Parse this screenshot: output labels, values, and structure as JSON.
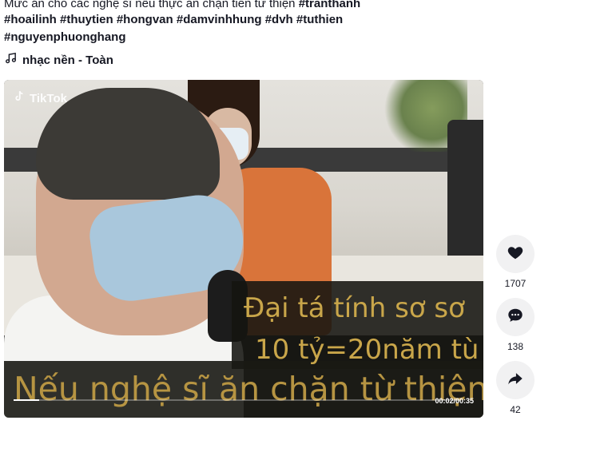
{
  "post": {
    "caption_line1": "Mức án cho các nghệ sĩ nếu thực ăn chặn tiền từ thiện",
    "hashtags_line1": "#tranthanh",
    "hashtags_line2": "#hoailinh #thuytien #hongvan #damvinhhung #dvh #tuthien",
    "hashtags_line3": "#nguyenphuonghang",
    "music_label": "nhạc nền - Toàn",
    "music_icon": "music-note-icon"
  },
  "video": {
    "watermark": "TikTok",
    "overlay_line1": "Đại tá tính sơ sơ",
    "overlay_line2": "10 tỷ=20năm tù",
    "overlay_line3": "Nếu nghệ sĩ ăn chặn từ thiện",
    "time_display": "00:02/00:35",
    "progress_fraction": 0.057
  },
  "actions": {
    "like": {
      "icon": "heart-icon",
      "count": "1707"
    },
    "comment": {
      "icon": "comment-icon",
      "count": "138"
    },
    "share": {
      "icon": "share-icon",
      "count": "42"
    }
  }
}
